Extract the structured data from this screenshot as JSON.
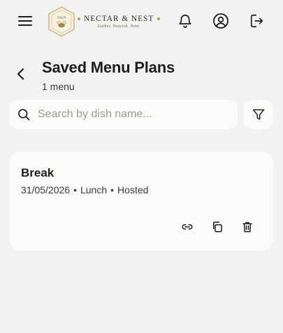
{
  "brand": {
    "name": "NECTAR & NEST",
    "tagline": "Gather. Nourish. Note.",
    "accent_color": "#b49a5a",
    "badge_letters": "N&N"
  },
  "header": {
    "menu_icon": "hamburger-menu-icon",
    "notifications_icon": "bell-icon",
    "profile_icon": "user-circle-icon",
    "logout_icon": "logout-icon"
  },
  "page": {
    "back_icon": "chevron-left-icon",
    "title": "Saved Menu Plans",
    "subtitle": "1 menu"
  },
  "search": {
    "placeholder": "Search by dish name...",
    "value": "",
    "icon": "search-icon"
  },
  "filter": {
    "icon": "filter-icon"
  },
  "menus": [
    {
      "title": "Break",
      "date": "31/05/2026",
      "meal": "Lunch",
      "type": "Hosted",
      "separator": "•",
      "actions": [
        "link-icon",
        "copy-icon",
        "trash-icon"
      ]
    }
  ]
}
